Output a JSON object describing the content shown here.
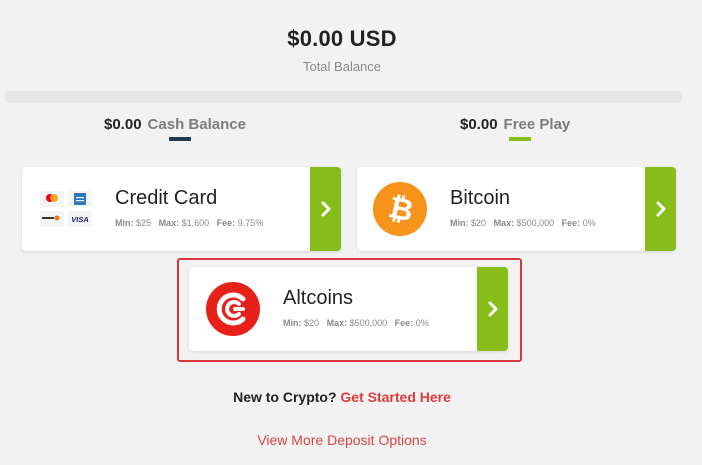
{
  "balance": {
    "total_amount": "$0.00 USD",
    "total_label": "Total Balance",
    "cash_amount": "$0.00",
    "cash_label": "Cash Balance",
    "free_amount": "$0.00",
    "free_label": "Free Play"
  },
  "methods": [
    {
      "name": "Credit Card",
      "min_label": "Min:",
      "min": "$25",
      "max_label": "Max:",
      "max": "$1,600",
      "fee_label": "Fee:",
      "fee": "9.75%",
      "icon": "credit-card-logos-icon"
    },
    {
      "name": "Bitcoin",
      "min_label": "Min:",
      "min": "$20",
      "max_label": "Max:",
      "max": "$500,000",
      "fee_label": "Fee:",
      "fee": "0%",
      "icon": "bitcoin-icon"
    },
    {
      "name": "Altcoins",
      "min_label": "Min:",
      "min": "$20",
      "max_label": "Max:",
      "max": "$500,000",
      "fee_label": "Fee:",
      "fee": "0%",
      "icon": "altcoins-icon",
      "highlighted": true
    }
  ],
  "footer": {
    "new_to_crypto": "New to Crypto?",
    "get_started": "Get Started Here",
    "more_options": "View More Deposit Options"
  },
  "card_brands": {
    "amex": "AMERICAN EXPRESS",
    "discover": "DISCOVER",
    "visa": "VISA",
    "mastercard": "mastercard"
  },
  "colors": {
    "accent_green": "#86bd1a",
    "accent_red": "#e03a3a",
    "cash_underline": "#1f3a4a",
    "free_underline": "#86bd1a",
    "bitcoin_orange": "#f7931a",
    "altcoins_red": "#e8201a"
  }
}
